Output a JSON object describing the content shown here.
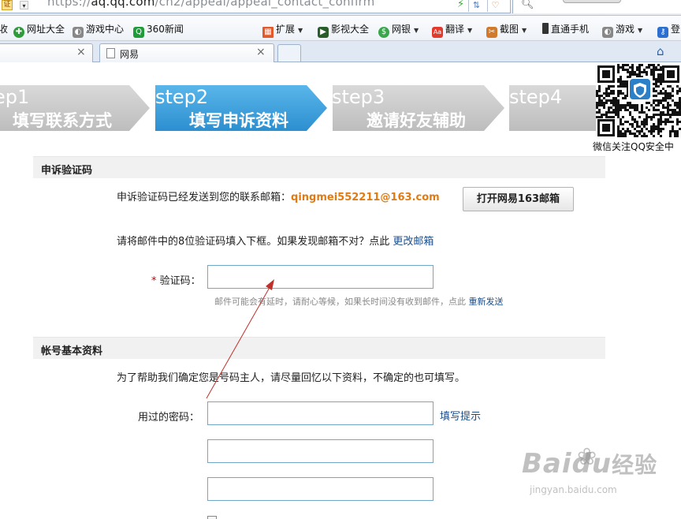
{
  "browser": {
    "cert_label": "证",
    "url_scheme": "https://",
    "url_host": "aq.qq.com",
    "url_path": "/cn2/appeal/appeal_contact_confirm",
    "favorites": [
      {
        "label": "收",
        "icon": ""
      },
      {
        "label": "网址大全",
        "icon": "globe"
      },
      {
        "label": "游戏中心",
        "icon": "gamepad"
      },
      {
        "label": "360新闻",
        "icon": "news"
      },
      {
        "label": "扩展",
        "icon": "grid"
      },
      {
        "label": "影视大全",
        "icon": "play"
      },
      {
        "label": "网银",
        "icon": "shield"
      },
      {
        "label": "翻译",
        "icon": "translate"
      },
      {
        "label": "截图",
        "icon": "scissors"
      },
      {
        "label": "直通手机",
        "icon": "phone"
      },
      {
        "label": "游戏",
        "icon": "gamepad"
      },
      {
        "label": "登",
        "icon": "key"
      }
    ],
    "tabs": [
      {
        "label": ""
      },
      {
        "label": "网易"
      }
    ]
  },
  "steps": [
    {
      "num": "ep1",
      "label": "填写联系方式",
      "active": false
    },
    {
      "num": "step2",
      "label": "填写申诉资料",
      "active": true
    },
    {
      "num": "step3",
      "label": "邀请好友辅助",
      "active": false
    },
    {
      "num": "step4",
      "label": "",
      "active": false
    }
  ],
  "qr": {
    "caption": "微信关注QQ安全中"
  },
  "verify": {
    "heading": "申诉验证码",
    "sent_text": "申诉验证码已经发送到您的联系邮箱：",
    "email": "qingmei552211@163.com",
    "open_mail_button": "打开网易163邮箱",
    "instruction": "请将邮件中的8位验证码填入下框。如果发现邮箱不对？点此",
    "change_email_link": "更改邮箱",
    "field_star": "*",
    "field_label": "验证码：",
    "hint": "邮件可能会有延时，请耐心等候，如果长时间没有收到邮件，点此",
    "resend_link": "重新发送"
  },
  "account": {
    "heading": "帐号基本资料",
    "intro": "为了帮助我们确定您是号码主人，请尽量回忆以下资料，不确定的也可填写。",
    "password_label": "用过的密码：",
    "fill_tip_link": "填写提示"
  },
  "watermark": {
    "brand": "Bai",
    "brand2": "du",
    "cn": "经验",
    "site": "jingyan.baidu.com"
  },
  "colors": {
    "step_active": "#3aa0dc",
    "step_inactive": "#cbcbcb",
    "email": "#e07b14",
    "link": "#1b4e8c",
    "arrow": "#c0302a"
  }
}
